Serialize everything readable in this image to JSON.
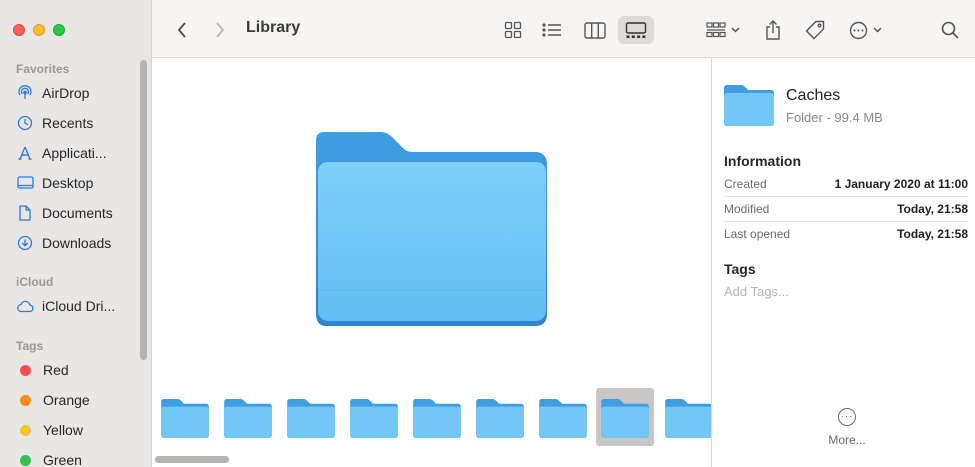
{
  "window": {
    "controls": [
      "close",
      "minimize",
      "zoom"
    ]
  },
  "sidebar": {
    "sections": {
      "favorites": "Favorites",
      "icloud": "iCloud",
      "tags": "Tags"
    },
    "favorites": [
      {
        "label": "AirDrop",
        "icon": "airdrop-icon"
      },
      {
        "label": "Recents",
        "icon": "clock-icon"
      },
      {
        "label": "Applicati...",
        "icon": "applications-icon"
      },
      {
        "label": "Desktop",
        "icon": "desktop-icon"
      },
      {
        "label": "Documents",
        "icon": "document-icon"
      },
      {
        "label": "Downloads",
        "icon": "download-icon"
      }
    ],
    "icloud": [
      {
        "label": "iCloud Dri...",
        "icon": "cloud-icon"
      }
    ],
    "tags": [
      {
        "label": "Red",
        "color": "#fe4a49"
      },
      {
        "label": "Orange",
        "color": "#f98b1b"
      },
      {
        "label": "Yellow",
        "color": "#f5c32a"
      },
      {
        "label": "Green",
        "color": "#34c04a"
      }
    ]
  },
  "toolbar": {
    "title": "Library",
    "view_selected": "gallery"
  },
  "gallery": {
    "thumbnail_count": 9,
    "selected_index": 7
  },
  "inspector": {
    "name": "Caches",
    "kind": "Folder - 99.4 MB",
    "information_heading": "Information",
    "rows": [
      {
        "key": "Created",
        "value": "1 January 2020 at 11:00"
      },
      {
        "key": "Modified",
        "value": "Today, 21:58"
      },
      {
        "key": "Last opened",
        "value": "Today, 21:58"
      }
    ],
    "tags_heading": "Tags",
    "tags_placeholder": "Add Tags...",
    "more_label": "More..."
  },
  "colors": {
    "accent": "#2a7ae2",
    "folder_light": "#76c8f7",
    "folder_dark": "#3f9ee2"
  }
}
